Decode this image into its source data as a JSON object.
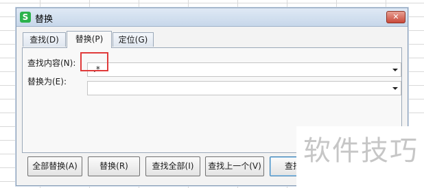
{
  "window": {
    "title": "替换",
    "app_icon_letter": "S",
    "close_symbol": "✕"
  },
  "tabs": [
    {
      "label": "查找(D)"
    },
    {
      "label": "替换(P)",
      "active": true
    },
    {
      "label": "定位(G)"
    }
  ],
  "form": {
    "find_label": "查找内容(N):",
    "find_value": ".*",
    "replace_label": "替换为(E):",
    "replace_value": ""
  },
  "buttons": {
    "replace_all": "全部替换(A)",
    "replace": "替换(R)",
    "find_all": "查找全部(I)",
    "find_previous": "查找上一个(V)",
    "find_next": "查找下"
  },
  "watermark": "软件技巧",
  "colors": {
    "highlight": "#e03a3a",
    "app_icon": "#2bb24c",
    "close_button": "#c9493a"
  }
}
